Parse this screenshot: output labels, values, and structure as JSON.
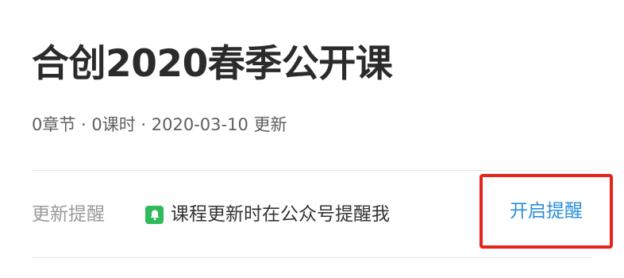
{
  "course": {
    "title": "合创2020春季公开课",
    "meta": "0章节 · 0课时 · 2020-03-10 更新"
  },
  "reminder": {
    "label": "更新提醒",
    "description": "课程更新时在公众号提醒我",
    "icon": "bell-icon",
    "action_label": "开启提醒"
  },
  "colors": {
    "title": "#2b2b2b",
    "meta": "#5f5f5f",
    "label": "#9a9a9a",
    "link": "#2b90d9",
    "badge": "#2fba5c",
    "highlight": "#e8231c",
    "divider": "#e6e6e6"
  }
}
